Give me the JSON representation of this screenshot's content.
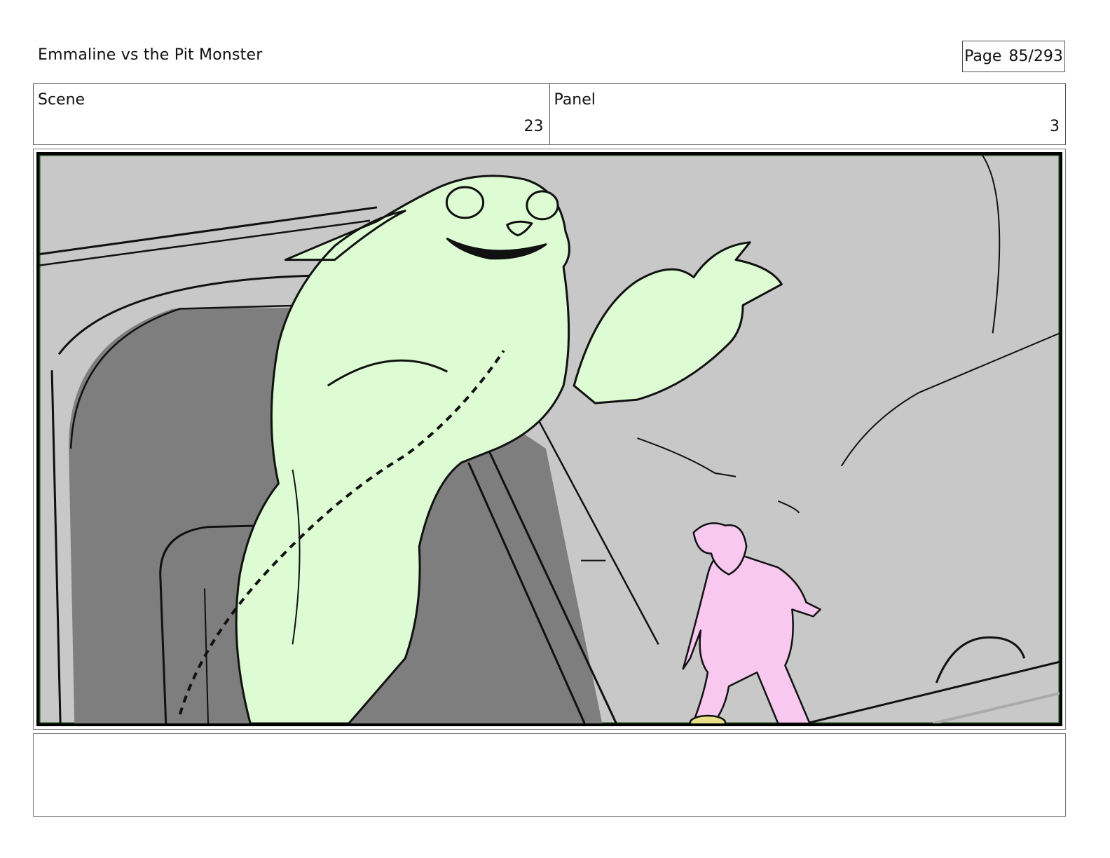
{
  "header": {
    "title": "Emmaline vs the Pit Monster",
    "page_label": "Page",
    "page_number": "85/293"
  },
  "info": {
    "scene_label": "Scene",
    "scene_value": "23",
    "panel_label": "Panel",
    "panel_value": "3"
  },
  "colors": {
    "monster_fill": "#ddfcd4",
    "girl_fill": "#f8c8f0",
    "background_gray": "#c8c8c8",
    "doorway_gray": "#7e7e7e",
    "frame_border": "#1b4d1b"
  },
  "notes": {
    "text": ""
  }
}
